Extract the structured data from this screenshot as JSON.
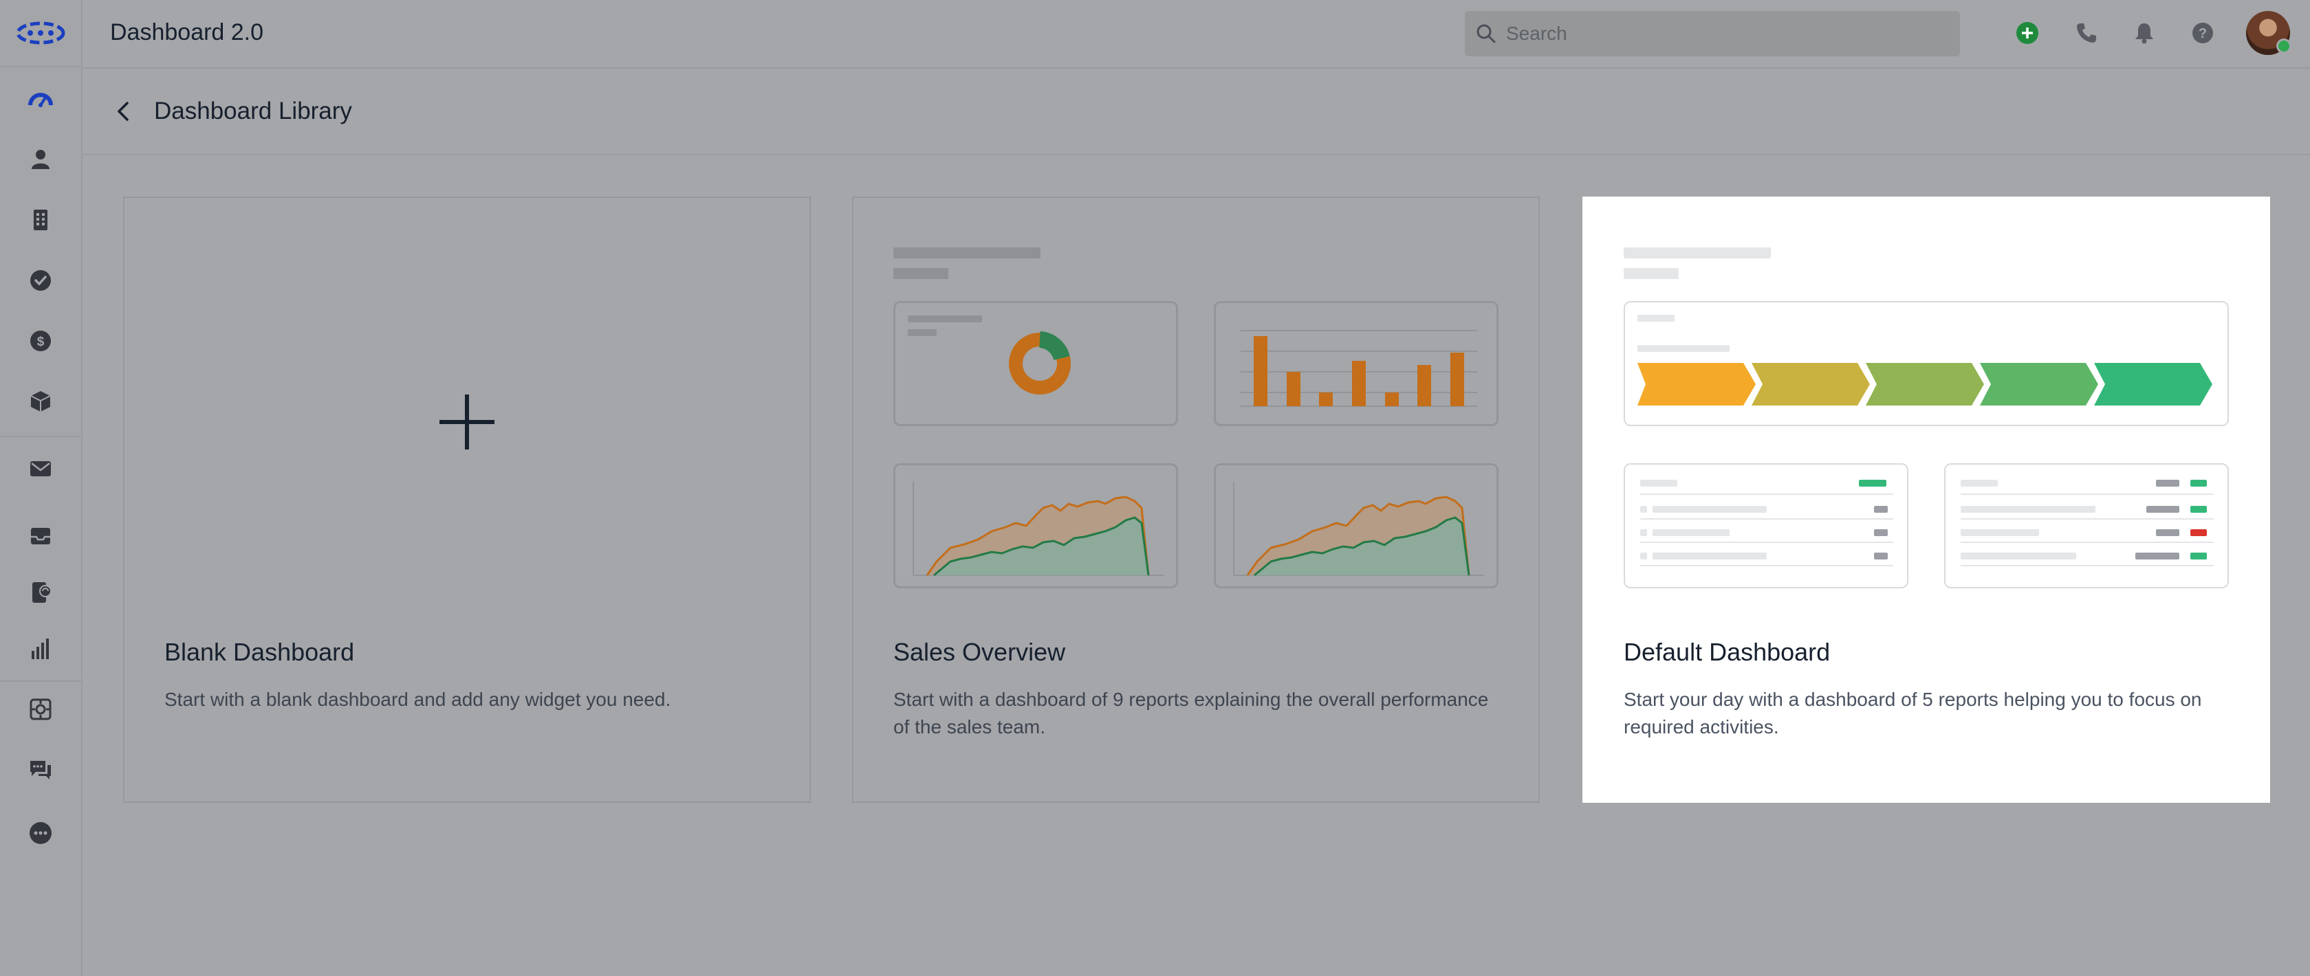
{
  "app": {
    "title": "Dashboard 2.0"
  },
  "search": {
    "placeholder": "Search"
  },
  "topbar": {
    "icons": [
      "add-icon",
      "phone-icon",
      "bell-icon",
      "help-icon"
    ]
  },
  "sidebar": {
    "items": [
      {
        "name": "dashboard-icon",
        "active": true
      },
      {
        "name": "contacts-icon"
      },
      {
        "name": "accounts-icon"
      },
      {
        "name": "tasks-icon"
      },
      {
        "name": "deals-icon"
      },
      {
        "name": "products-icon"
      },
      {
        "name": "email-icon"
      },
      {
        "name": "inbox-icon"
      },
      {
        "name": "phone-log-icon"
      },
      {
        "name": "reports-icon"
      },
      {
        "name": "automation-icon"
      },
      {
        "name": "chat-icon"
      },
      {
        "name": "more-icon"
      }
    ]
  },
  "page": {
    "title": "Dashboard Library"
  },
  "cards": [
    {
      "title": "Blank Dashboard",
      "description": "Start with a blank dashboard and add any widget you need."
    },
    {
      "title": "Sales Overview",
      "description": "Start with a dashboard of 9 reports explaining the overall performance of the sales team."
    },
    {
      "title": "Default Dashboard",
      "description": "Start your day with a dashboard of 5 reports helping you to focus on required activities.",
      "selected": true
    }
  ],
  "colors": {
    "orange": "#e07c1a",
    "green": "#2fa865",
    "red": "#d9352b",
    "brand_blue": "#1b3fbf",
    "funnel": [
      "#f4a928",
      "#c9b23f",
      "#92b452",
      "#5db566",
      "#34b87a"
    ]
  }
}
